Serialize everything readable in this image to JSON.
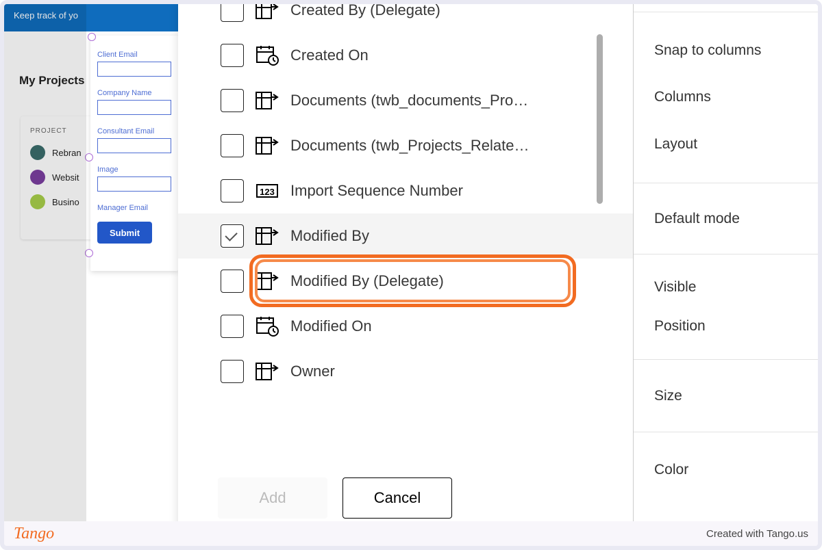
{
  "banner": {
    "text": "Keep track of yo"
  },
  "sidebar": {
    "title": "My Projects",
    "header": "PROJECT",
    "rows": [
      {
        "label": "Rebran",
        "color": "#3a6c6b"
      },
      {
        "label": "Websit",
        "color": "#7b3fa0"
      },
      {
        "label": "Busino",
        "color": "#a7cf4a"
      }
    ]
  },
  "form": {
    "fields": [
      {
        "label": "Client Email"
      },
      {
        "label": "Company Name"
      },
      {
        "label": "Consultant Email"
      },
      {
        "label": "Image"
      },
      {
        "label": "Manager Email"
      }
    ],
    "submit": "Submit"
  },
  "fieldList": {
    "items": [
      {
        "label": "Created By (Delegate)",
        "icon": "lookup"
      },
      {
        "label": "Created On",
        "icon": "date"
      },
      {
        "label": "Documents (twb_documents_Pro…",
        "icon": "lookup"
      },
      {
        "label": "Documents (twb_Projects_Relate…",
        "icon": "lookup"
      },
      {
        "label": "Import Sequence Number",
        "icon": "number"
      },
      {
        "label": "Modified By",
        "icon": "lookup",
        "checked": true
      },
      {
        "label": "Modified By (Delegate)",
        "icon": "lookup"
      },
      {
        "label": "Modified On",
        "icon": "date"
      },
      {
        "label": "Owner",
        "icon": "lookup"
      }
    ],
    "add": "Add",
    "cancel": "Cancel"
  },
  "rightPanel": {
    "g1a": "Snap to columns",
    "g1b": "Columns",
    "g1c": "Layout",
    "defaultMode": "Default mode",
    "visible": "Visible",
    "position": "Position",
    "size": "Size",
    "color": "Color"
  },
  "footer": {
    "brand": "Tango",
    "credit": "Created with Tango.us"
  }
}
